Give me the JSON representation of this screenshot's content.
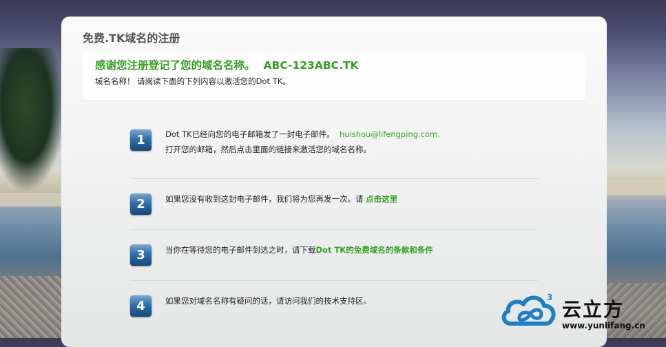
{
  "panel": {
    "title": "免费.TK域名的注册",
    "thanks_title": "感谢您注册登记了您的域名名称。",
    "domain": "ABC-123ABC.TK",
    "subtitle": "域名名称！ 请阅读下面的下列内容以激活您的Dot TK。"
  },
  "steps": [
    {
      "num": "1",
      "line1_prefix": "Dot TK已经向您的电子邮箱发了一封电子邮件。",
      "email": "huishou@lifengping.com.",
      "line2": "打开您的邮箱，然后点击里面的链接来激活您的域名名称。"
    },
    {
      "num": "2",
      "text": "如果您没有收到这封电子邮件，我们将为您再发一次。请 ",
      "link": "点击这里"
    },
    {
      "num": "3",
      "text": "当你在等待您的电子邮件到达之时，请下载",
      "link": "Dot TK的免费域名的条款和条件"
    },
    {
      "num": "4",
      "text": "如果您对域名名称有疑问的话，请访问我们的技术支持区。"
    }
  ],
  "watermark": {
    "brand": "云立方",
    "url": "www.yunlifang.cn",
    "sup": "3",
    "icon": "cloud-logo-icon"
  },
  "colors": {
    "accent": "#33a020",
    "badge": "#2f6fa7"
  }
}
